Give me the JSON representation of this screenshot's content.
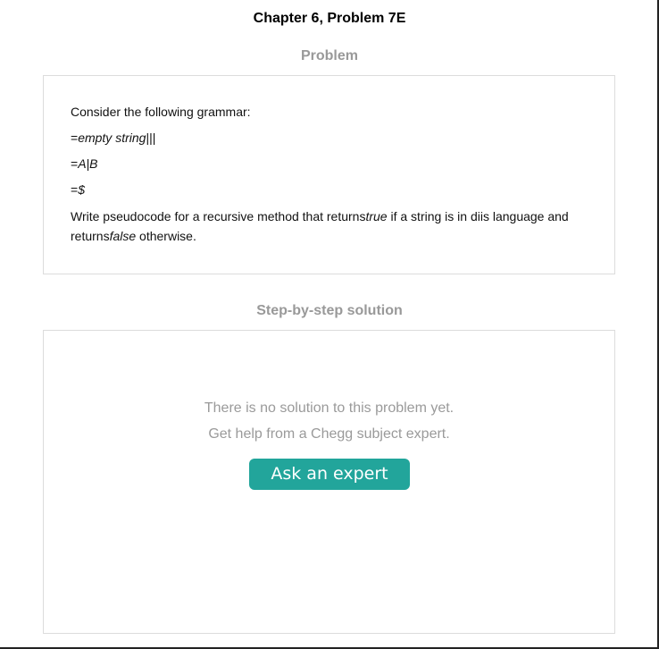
{
  "header": {
    "chapter_title": "Chapter 6, Problem 7E"
  },
  "problem": {
    "heading": "Problem",
    "intro": "Consider the following grammar:",
    "rule1_prefix": "=",
    "rule1_body": "empty string",
    "rule1_suffix": "|||",
    "rule2_prefix": "=",
    "rule2_body": "A|B",
    "rule3_prefix": "=",
    "rule3_body": "$",
    "question_part1": "Write pseudocode for a recursive method that returns",
    "question_true": "true",
    "question_part2": " if a string is in diis language and returns",
    "question_false": "false",
    "question_part3": " otherwise."
  },
  "solution": {
    "heading": "Step-by-step solution",
    "no_solution_text": "There is no solution to this problem yet.",
    "help_text": "Get help from a Chegg subject expert.",
    "ask_button_label": "Ask an expert"
  },
  "colors": {
    "accent": "#22a59b",
    "muted_text": "#9a9a9a",
    "box_border": "#dcdcdc"
  }
}
